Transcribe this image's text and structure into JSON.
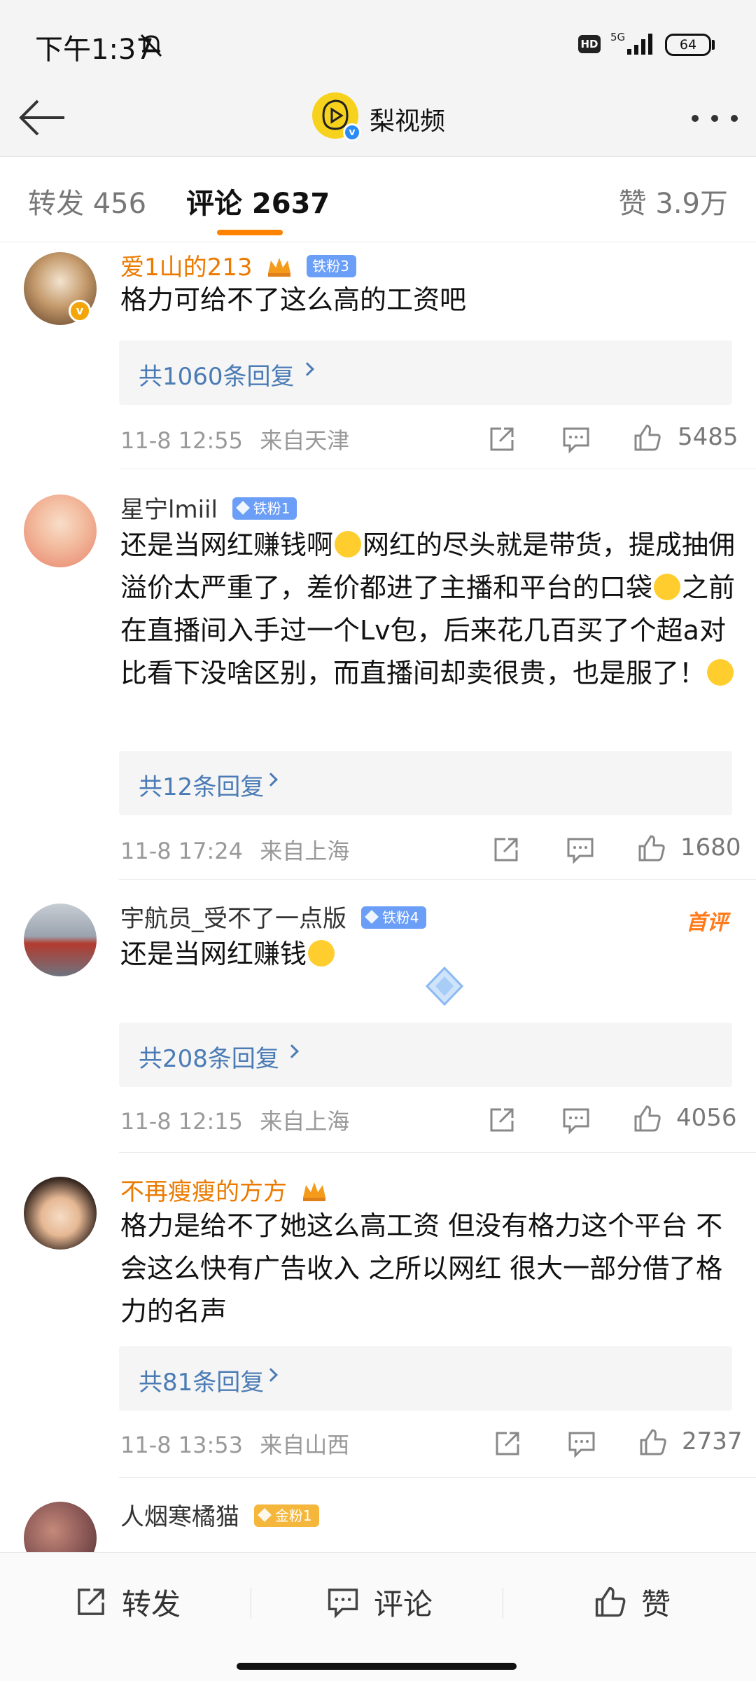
{
  "status_bar": {
    "time": "下午1:37",
    "hd": "HD",
    "network": "5G",
    "battery": "64"
  },
  "header": {
    "title": "梨视频",
    "logo_color": "#f7d21c"
  },
  "tabs": {
    "repost": "转发 456",
    "comments": "评论 2637",
    "likes": "赞 3.9万",
    "accent": "#ff8200"
  },
  "comments": [
    {
      "username": "爱1山的213",
      "fan_badge": "铁粉3",
      "text": "格力可给不了这么高的工资吧",
      "replies": "共1060条回复",
      "time": "11-8 12:55",
      "location": "来自天津",
      "likes": "5485"
    },
    {
      "username": "星宁lmiil",
      "fan_badge": "铁粉1",
      "text_parts": [
        "还是当网红赚钱啊",
        "网红的尽头就是带货，提成抽佣溢价太严重了，差价都进了主播和平台的口袋",
        "之前在直播间入手过一个Lv包，后来花几百买了个超a对比看下没啥区别，而直播间却卖很贵，也是服了！"
      ],
      "replies": "共12条回复",
      "time": "11-8 17:24",
      "location": "来自上海",
      "likes": "1680"
    },
    {
      "username": "宇航员_受不了一点版",
      "fan_badge": "铁粉4",
      "first_badge": "首评",
      "text": "还是当网红赚钱",
      "replies": "共208条回复",
      "time": "11-8 12:15",
      "location": "来自上海",
      "likes": "4056"
    },
    {
      "username": "不再瘦瘦的方方",
      "text": "格力是给不了她这么高工资  但没有格力这个平台  不会这么快有广告收入  之所以网红  很大一部分借了格力的名声",
      "replies": "共81条回复",
      "time": "11-8 13:53",
      "location": "来自山西",
      "likes": "2737"
    },
    {
      "username": "人烟寒橘猫",
      "fan_badge": "金粉1"
    }
  ],
  "bottom_bar": {
    "repost": "转发",
    "comment": "评论",
    "like": "赞"
  }
}
